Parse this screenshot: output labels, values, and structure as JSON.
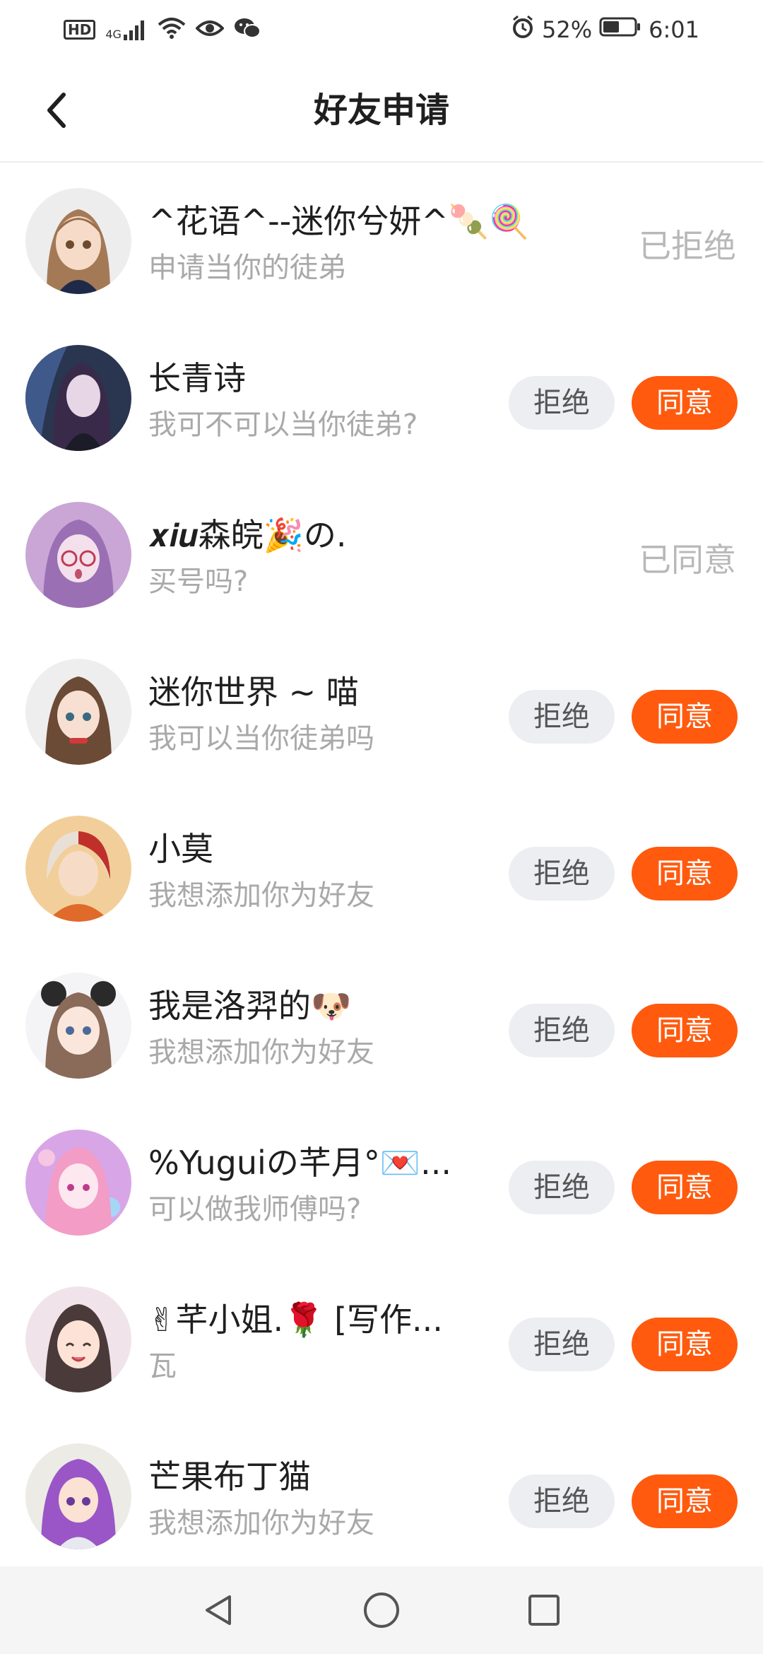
{
  "status_bar": {
    "left_icons": [
      "hd-icon",
      "signal-4g-icon",
      "wifi-icon",
      "eye-icon",
      "wechat-icon"
    ],
    "hd_label": "HD",
    "network_label": "4G",
    "alarm_icon": "alarm-icon",
    "battery_percent": "52%",
    "battery_level": 0.52,
    "time": "6:01"
  },
  "header": {
    "title": "好友申请",
    "back_icon": "chevron-left-icon"
  },
  "labels": {
    "reject": "拒绝",
    "accept": "同意"
  },
  "colors": {
    "accent": "#ff5a0e",
    "reject_bg": "#eceef2",
    "secondary_text": "#a9a9a9",
    "status_text": "#b8b8b8"
  },
  "requests": [
    {
      "name": "^花语^--迷你兮妍^🍡🍭",
      "message": "申请当你的徒弟",
      "status": "已拒绝"
    },
    {
      "name": "长青诗",
      "message": "我可不可以当你徒弟?",
      "status": ""
    },
    {
      "name": "𝒙𝒊𝒖森皖🎉の.",
      "message": "买号吗?",
      "status": "已同意"
    },
    {
      "name": "迷你世界 ~ 喵",
      "message": "我可以当你徒弟吗",
      "status": ""
    },
    {
      "name": "小莫",
      "message": "我想添加你为好友",
      "status": ""
    },
    {
      "name": "我是洛羿的🐶",
      "message": "我想添加你为好友",
      "status": ""
    },
    {
      "name": "%Yuguiの芊月°💌...",
      "message": "可以做我师傅吗?",
      "status": ""
    },
    {
      "name": "✌芊小姐.🌹 [写作...",
      "message": "瓦",
      "status": ""
    },
    {
      "name": "芒果布丁猫",
      "message": "我想添加你为好友",
      "status": ""
    }
  ],
  "nav_bar": {
    "icons": [
      "nav-back-icon",
      "nav-home-icon",
      "nav-recents-icon"
    ]
  }
}
